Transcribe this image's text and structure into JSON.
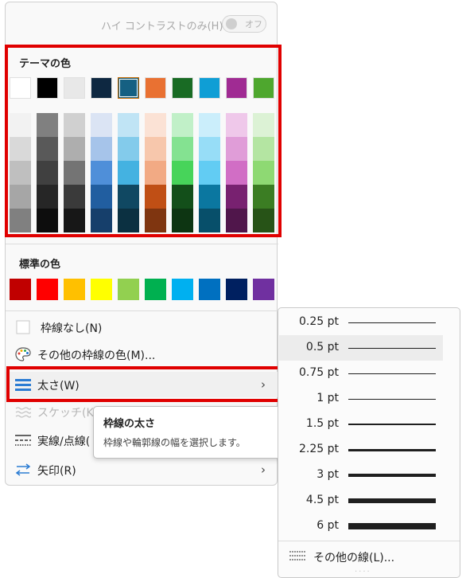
{
  "high_contrast": {
    "label": "ハイ コントラストのみ(H)",
    "toggle": "オフ"
  },
  "theme": {
    "title": "テーマの色",
    "base": [
      "#ffffff",
      "#000000",
      "#e8e8e8",
      "#0e2841",
      "#156082",
      "#e97132",
      "#196b24",
      "#0f9ed5",
      "#a02b93",
      "#4ea72e"
    ],
    "selected_index": 4,
    "shades": [
      [
        "#f2f2f2",
        "#d9d9d9",
        "#bfbfbf",
        "#a6a6a6",
        "#808080"
      ],
      [
        "#808080",
        "#595959",
        "#404040",
        "#262626",
        "#0d0d0d"
      ],
      [
        "#d0d0d0",
        "#aeaeae",
        "#747474",
        "#3a3a3a",
        "#171717"
      ],
      [
        "#dbe4f4",
        "#a6c4ea",
        "#4f8fd9",
        "#215ea0",
        "#163f6b"
      ],
      [
        "#c0e4f5",
        "#83cbeb",
        "#44b2e1",
        "#104862",
        "#0b3041"
      ],
      [
        "#fbe2d5",
        "#f7c7ac",
        "#f2aa84",
        "#c04f15",
        "#7f3510"
      ],
      [
        "#c1f0c8",
        "#84e291",
        "#47d45a",
        "#134f1a",
        "#0d3512"
      ],
      [
        "#cbeefb",
        "#97ddf7",
        "#62ccf3",
        "#0b77a0",
        "#074f6a"
      ],
      [
        "#efc8ea",
        "#e09dd8",
        "#d16ec5",
        "#782170",
        "#50164b"
      ],
      [
        "#dcf2d5",
        "#b4e5a2",
        "#8ed973",
        "#3b7d23",
        "#275317"
      ]
    ]
  },
  "standard": {
    "title": "標準の色",
    "colors": [
      "#c00000",
      "#ff0000",
      "#ffc000",
      "#ffff00",
      "#92d050",
      "#00b050",
      "#00b0f0",
      "#0070c0",
      "#002060",
      "#7030a0"
    ]
  },
  "menu": {
    "no_outline": "枠線なし(N)",
    "more_colors": "その他の枠線の色(M)...",
    "weight": "太さ(W)",
    "sketch": "スケッチ(K)",
    "dashes": "実線/点線(",
    "arrows": "矢印(R)"
  },
  "tooltip": {
    "title": "枠線の太さ",
    "body": "枠線や輪郭線の幅を選択します。"
  },
  "weights": {
    "items": [
      {
        "label": "0.25 pt",
        "thickness": 0.25
      },
      {
        "label": "0.5 pt",
        "thickness": 0.5
      },
      {
        "label": "0.75 pt",
        "thickness": 0.75
      },
      {
        "label": "1 pt",
        "thickness": 1
      },
      {
        "label": "1.5 pt",
        "thickness": 1.5
      },
      {
        "label": "2.25 pt",
        "thickness": 2.25
      },
      {
        "label": "3 pt",
        "thickness": 3
      },
      {
        "label": "4.5 pt",
        "thickness": 4.5
      },
      {
        "label": "6 pt",
        "thickness": 6
      }
    ],
    "selected_index": 1,
    "more": "その他の線(L)..."
  }
}
